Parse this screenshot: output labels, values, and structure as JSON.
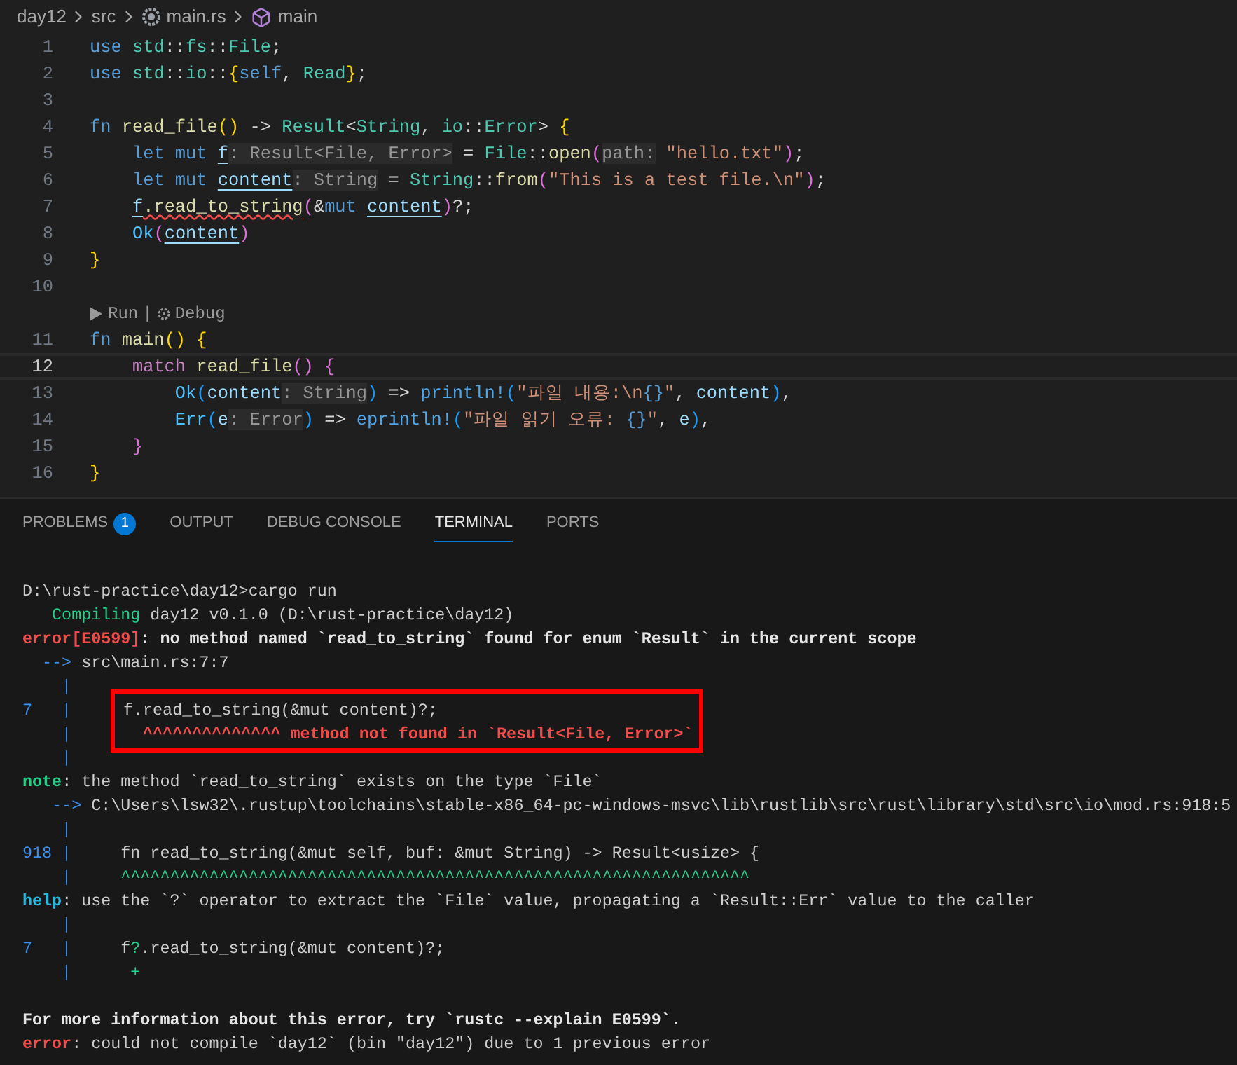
{
  "breadcrumb": [
    {
      "kind": "folder",
      "label": "day12"
    },
    {
      "kind": "folder",
      "label": "src"
    },
    {
      "kind": "file",
      "label": "main.rs"
    },
    {
      "kind": "symbol",
      "label": "main"
    }
  ],
  "editor": {
    "lines": [
      {
        "number": "1",
        "current": false,
        "tokens": [
          {
            "kind": "kw",
            "text": "use "
          },
          {
            "kind": "type",
            "text": "std"
          },
          {
            "kind": "p",
            "text": "::"
          },
          {
            "kind": "type",
            "text": "fs"
          },
          {
            "kind": "p",
            "text": "::"
          },
          {
            "kind": "type",
            "text": "File"
          },
          {
            "kind": "p",
            "text": ";"
          }
        ]
      },
      {
        "number": "2",
        "current": false,
        "tokens": [
          {
            "kind": "kw",
            "text": "use "
          },
          {
            "kind": "type",
            "text": "std"
          },
          {
            "kind": "p",
            "text": "::"
          },
          {
            "kind": "type",
            "text": "io"
          },
          {
            "kind": "p",
            "text": "::"
          },
          {
            "kind": "b1",
            "text": "{"
          },
          {
            "kind": "kw",
            "text": "self"
          },
          {
            "kind": "p",
            "text": ", "
          },
          {
            "kind": "type",
            "text": "Read"
          },
          {
            "kind": "b1",
            "text": "}"
          },
          {
            "kind": "p",
            "text": ";"
          }
        ]
      },
      {
        "number": "3",
        "current": false
      },
      {
        "number": "4",
        "current": false,
        "tokens": [
          {
            "kind": "kw",
            "text": "fn "
          },
          {
            "kind": "fn",
            "text": "read_file"
          },
          {
            "kind": "b1",
            "text": "()"
          },
          {
            "kind": "p",
            "text": " -> "
          },
          {
            "kind": "type",
            "text": "Result"
          },
          {
            "kind": "p",
            "text": "<"
          },
          {
            "kind": "type",
            "text": "String"
          },
          {
            "kind": "p",
            "text": ", "
          },
          {
            "kind": "type",
            "text": "io"
          },
          {
            "kind": "p",
            "text": "::"
          },
          {
            "kind": "type",
            "text": "Error"
          },
          {
            "kind": "p",
            "text": "> "
          },
          {
            "kind": "b1",
            "text": "{"
          }
        ]
      },
      {
        "number": "5",
        "current": false,
        "tokens": [
          {
            "kind": "kw",
            "text": "    let mut "
          },
          {
            "kind": "mvar",
            "text": "f"
          },
          {
            "kind": "hint",
            "text": ": Result<File, Error>"
          },
          {
            "kind": "p",
            "text": " = "
          },
          {
            "kind": "type",
            "text": "File"
          },
          {
            "kind": "p",
            "text": "::"
          },
          {
            "kind": "fn",
            "text": "open"
          },
          {
            "kind": "b2",
            "text": "("
          },
          {
            "kind": "hint",
            "text": "path:"
          },
          {
            "kind": "str",
            "text": " \"hello.txt\""
          },
          {
            "kind": "b2",
            "text": ")"
          },
          {
            "kind": "p",
            "text": ";"
          }
        ]
      },
      {
        "number": "6",
        "current": false,
        "tokens": [
          {
            "kind": "kw",
            "text": "    let mut "
          },
          {
            "kind": "mvar",
            "text": "content"
          },
          {
            "kind": "hint",
            "text": ": String"
          },
          {
            "kind": "p",
            "text": " = "
          },
          {
            "kind": "type",
            "text": "String"
          },
          {
            "kind": "p",
            "text": "::"
          },
          {
            "kind": "fn",
            "text": "from"
          },
          {
            "kind": "b2",
            "text": "("
          },
          {
            "kind": "str",
            "text": "\"This is a test file.\\n\""
          },
          {
            "kind": "b2",
            "text": ")"
          },
          {
            "kind": "p",
            "text": ";"
          }
        ]
      },
      {
        "number": "7",
        "current": false,
        "tokens": [
          {
            "kind": "mvar",
            "text": "    f"
          },
          {
            "kind": "fn_err",
            "text": ".read_to_string"
          },
          {
            "kind": "b2",
            "text": "("
          },
          {
            "kind": "p",
            "text": "&"
          },
          {
            "kind": "kw",
            "text": "mut "
          },
          {
            "kind": "mvar",
            "text": "content"
          },
          {
            "kind": "b2",
            "text": ")"
          },
          {
            "kind": "p",
            "text": "?;"
          }
        ]
      },
      {
        "number": "8",
        "current": false,
        "tokens": [
          {
            "kind": "variant",
            "text": "    Ok"
          },
          {
            "kind": "b2",
            "text": "("
          },
          {
            "kind": "mvar",
            "text": "content"
          },
          {
            "kind": "b2",
            "text": ")"
          }
        ]
      },
      {
        "number": "9",
        "current": false,
        "tokens": [
          {
            "kind": "b1",
            "text": "}"
          }
        ]
      },
      {
        "number": "10",
        "current": false
      },
      {
        "number": "11",
        "current": false,
        "codelens": [
          "Run",
          "|",
          "Debug"
        ],
        "tokens": [
          {
            "kind": "kw",
            "text": "fn "
          },
          {
            "kind": "fn",
            "text": "main"
          },
          {
            "kind": "b1",
            "text": "()"
          },
          {
            "kind": "b1",
            "text": " {"
          }
        ]
      },
      {
        "number": "12",
        "current": true,
        "tokens": [
          {
            "kind": "ctrl",
            "text": "    match "
          },
          {
            "kind": "fn",
            "text": "read_file"
          },
          {
            "kind": "b2",
            "text": "()"
          },
          {
            "kind": "b2",
            "text": " {"
          }
        ]
      },
      {
        "number": "13",
        "current": false,
        "tokens": [
          {
            "kind": "variant",
            "text": "        Ok"
          },
          {
            "kind": "b3",
            "text": "("
          },
          {
            "kind": "var",
            "text": "content"
          },
          {
            "kind": "hint",
            "text": ": String"
          },
          {
            "kind": "b3",
            "text": ")"
          },
          {
            "kind": "p",
            "text": " => "
          },
          {
            "kind": "macro",
            "text": "println!"
          },
          {
            "kind": "b3",
            "text": "("
          },
          {
            "kind": "str",
            "text": "\"파일 내용:\\n"
          },
          {
            "kind": "fmt",
            "text": "{}"
          },
          {
            "kind": "str",
            "text": "\""
          },
          {
            "kind": "p",
            "text": ", "
          },
          {
            "kind": "var",
            "text": "content"
          },
          {
            "kind": "b3",
            "text": ")"
          },
          {
            "kind": "p",
            "text": ","
          }
        ]
      },
      {
        "number": "14",
        "current": false,
        "tokens": [
          {
            "kind": "variant",
            "text": "        Err"
          },
          {
            "kind": "b3",
            "text": "("
          },
          {
            "kind": "var",
            "text": "e"
          },
          {
            "kind": "hint",
            "text": ": Error"
          },
          {
            "kind": "b3",
            "text": ")"
          },
          {
            "kind": "p",
            "text": " => "
          },
          {
            "kind": "macro",
            "text": "eprintln!"
          },
          {
            "kind": "b3",
            "text": "("
          },
          {
            "kind": "str",
            "text": "\"파일 읽기 오류: "
          },
          {
            "kind": "fmt",
            "text": "{}"
          },
          {
            "kind": "str",
            "text": "\""
          },
          {
            "kind": "p",
            "text": ", "
          },
          {
            "kind": "var",
            "text": "e"
          },
          {
            "kind": "b3",
            "text": ")"
          },
          {
            "kind": "p",
            "text": ","
          }
        ]
      },
      {
        "number": "15",
        "current": false,
        "tokens": [
          {
            "kind": "b2",
            "text": "    }"
          }
        ]
      },
      {
        "number": "16",
        "current": false,
        "tokens": [
          {
            "kind": "b1",
            "text": "}"
          }
        ]
      }
    ]
  },
  "panel": {
    "tabs": [
      {
        "label": "PROBLEMS",
        "badge": "1",
        "selected": false
      },
      {
        "label": "OUTPUT",
        "selected": false
      },
      {
        "label": "DEBUG CONSOLE",
        "selected": false
      },
      {
        "label": "TERMINAL",
        "selected": true
      },
      {
        "label": "PORTS",
        "selected": false
      }
    ],
    "terminal": [
      {
        "kind": "line",
        "segments": [
          {
            "kind": "p",
            "text": "D:\\rust-practice\\day12>cargo run"
          }
        ]
      },
      {
        "kind": "line",
        "segments": [
          {
            "kind": "green",
            "text": "   Compiling"
          },
          {
            "kind": "p",
            "text": " day12 v0.1.0 (D:\\rust-practice\\day12)"
          }
        ]
      },
      {
        "kind": "line",
        "segments": [
          {
            "kind": "error",
            "text": "error[E0599]"
          },
          {
            "kind": "bold",
            "text": ": no method named `read_to_string` found for enum `Result` in the current scope"
          }
        ]
      },
      {
        "kind": "line",
        "segments": [
          {
            "kind": "blue",
            "text": "  --> "
          },
          {
            "kind": "p",
            "text": "src\\main.rs:7:7"
          }
        ]
      },
      {
        "kind": "line",
        "segments": [
          {
            "kind": "blue",
            "text": "    |"
          }
        ]
      },
      {
        "kind": "box",
        "lines": [
          {
            "gutter": "7   |",
            "segments": [
              {
                "kind": "p",
                "text": "f.read_to_string(&mut content)?;"
              }
            ]
          },
          {
            "gutter": "    |",
            "segments": [
              {
                "kind": "error",
                "text": "  ^^^^^^^^^^^^^^ method not found in `Result<File, Error>`"
              }
            ]
          }
        ]
      },
      {
        "kind": "line",
        "segments": [
          {
            "kind": "blue",
            "text": "    |"
          }
        ]
      },
      {
        "kind": "line",
        "segments": [
          {
            "kind": "note",
            "text": "note"
          },
          {
            "kind": "p",
            "text": ": the method `read_to_string` exists on the type `File`"
          }
        ]
      },
      {
        "kind": "line",
        "segments": [
          {
            "kind": "blue",
            "text": "   --> "
          },
          {
            "kind": "p",
            "text": "C:\\Users\\lsw32\\.rustup\\toolchains\\stable-x86_64-pc-windows-msvc\\lib\\rustlib\\src\\rust\\library\\std\\src\\io\\mod.rs:918:5"
          }
        ]
      },
      {
        "kind": "line",
        "segments": [
          {
            "kind": "blue",
            "text": "    |"
          }
        ]
      },
      {
        "kind": "line",
        "segments": [
          {
            "kind": "blue",
            "text": "918 |"
          },
          {
            "kind": "p",
            "text": "     fn read_to_string(&mut self, buf: &mut String) -> Result<usize> {"
          }
        ]
      },
      {
        "kind": "line",
        "segments": [
          {
            "kind": "blue",
            "text": "    |"
          },
          {
            "kind": "green",
            "text": "     ^^^^^^^^^^^^^^^^^^^^^^^^^^^^^^^^^^^^^^^^^^^^^^^^^^^^^^^^^^^^^^^^"
          }
        ]
      },
      {
        "kind": "line",
        "segments": [
          {
            "kind": "help",
            "text": "help"
          },
          {
            "kind": "p",
            "text": ": use the `?` operator to extract the `File` value, propagating a `Result::Err` value to the caller"
          }
        ]
      },
      {
        "kind": "line",
        "segments": [
          {
            "kind": "blue",
            "text": "    |"
          }
        ]
      },
      {
        "kind": "line",
        "segments": [
          {
            "kind": "blue",
            "text": "7   |"
          },
          {
            "kind": "p",
            "text": "     f"
          },
          {
            "kind": "green",
            "text": "?"
          },
          {
            "kind": "p",
            "text": ".read_to_string(&mut content)?;"
          }
        ]
      },
      {
        "kind": "line",
        "segments": [
          {
            "kind": "blue",
            "text": "    |"
          },
          {
            "kind": "green",
            "text": "      +"
          }
        ]
      },
      {
        "kind": "line"
      },
      {
        "kind": "line",
        "segments": [
          {
            "kind": "bold",
            "text": "For more information about this error, try `rustc --explain E0599`."
          }
        ]
      },
      {
        "kind": "line",
        "segments": [
          {
            "kind": "error",
            "text": "error"
          },
          {
            "kind": "p",
            "text": ": could not compile `day12` (bin \"day12\") due to 1 previous error"
          }
        ]
      }
    ]
  }
}
